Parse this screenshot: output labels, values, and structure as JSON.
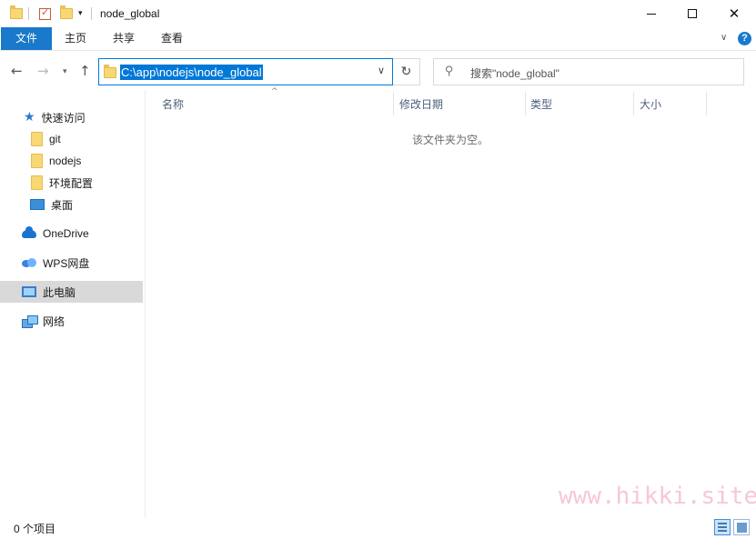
{
  "window": {
    "title": "node_global",
    "controls": {
      "minimize": "minimize",
      "maximize": "maximize",
      "close": "close"
    }
  },
  "ribbon": {
    "tabs": [
      {
        "label": "文件",
        "active": true
      },
      {
        "label": "主页"
      },
      {
        "label": "共享"
      },
      {
        "label": "查看"
      }
    ],
    "help": "?"
  },
  "navigation": {
    "back_icon": "back-arrow",
    "forward_icon": "forward-arrow",
    "recent_icon": "chevron-down",
    "up_icon": "up-arrow"
  },
  "address_bar": {
    "path": "C:\\app\\nodejs\\node_global",
    "selected": true
  },
  "search": {
    "placeholder": "搜索\"node_global\""
  },
  "sidebar": {
    "items": [
      {
        "label": "快速访问",
        "icon": "star-icon"
      },
      {
        "label": "git",
        "icon": "folder-icon"
      },
      {
        "label": "nodejs",
        "icon": "folder-icon"
      },
      {
        "label": "环境配置",
        "icon": "folder-icon"
      },
      {
        "label": "桌面",
        "icon": "desktop-icon"
      },
      {
        "label": "OneDrive",
        "icon": "cloud-icon"
      },
      {
        "label": "WPS网盘",
        "icon": "wps-cloud-icon"
      },
      {
        "label": "此电脑",
        "icon": "computer-icon",
        "selected": true
      },
      {
        "label": "网络",
        "icon": "network-icon"
      }
    ]
  },
  "columns": [
    {
      "label": "名称"
    },
    {
      "label": "修改日期"
    },
    {
      "label": "类型"
    },
    {
      "label": "大小"
    }
  ],
  "content": {
    "empty_message": "该文件夹为空。"
  },
  "status": {
    "item_count": "0 个项目"
  },
  "watermark": "www.hikki.site",
  "colors": {
    "accent": "#1979ca",
    "selection": "#0078d7",
    "sidebar_selected": "#d9d9d9",
    "watermark": "#f7c6db"
  }
}
